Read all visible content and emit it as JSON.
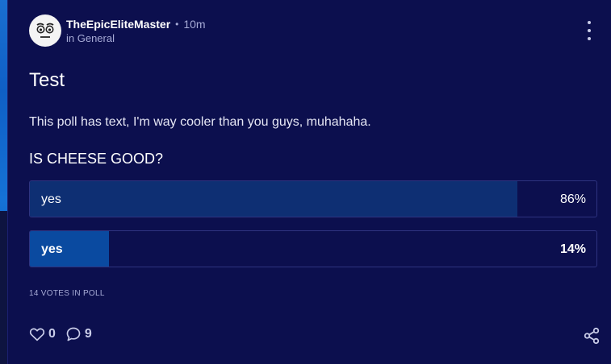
{
  "post": {
    "author": "TheEpicEliteMaster",
    "separator": "•",
    "time": "10m",
    "community": "in General",
    "title": "Test",
    "body": "This poll has text, I'm way cooler than you guys, muhahaha.",
    "poll": {
      "question": "IS CHEESE GOOD?",
      "options": [
        {
          "label": "yes",
          "percent_label": "86%",
          "percent": 86
        },
        {
          "label": "yes",
          "percent_label": "14%",
          "percent": 14,
          "selected": true
        }
      ],
      "votes_label": "14 VOTES IN POLL"
    },
    "likes": "0",
    "comments": "9"
  },
  "icons": {
    "menu": "kebab-menu-icon",
    "like": "heart-icon",
    "comment": "comment-icon",
    "share": "share-icon"
  },
  "colors": {
    "background": "#0c0f4e",
    "bar_fill": "#0e2f73",
    "bar_fill_selected": "#0a4aa0",
    "muted_text": "#a7abd6"
  }
}
